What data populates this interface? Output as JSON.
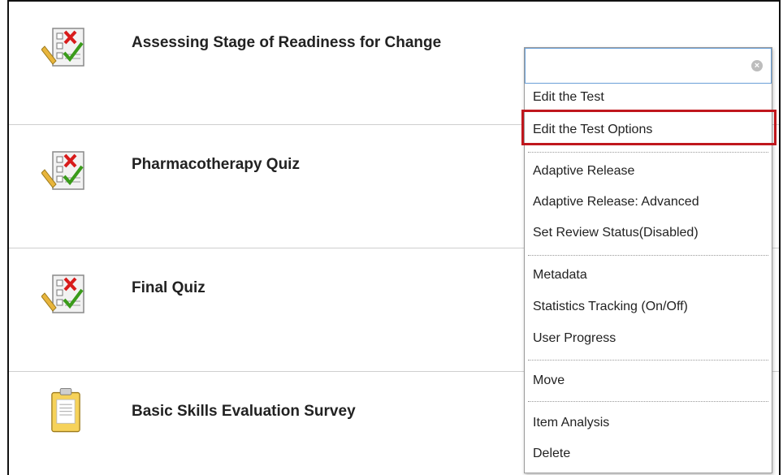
{
  "items": [
    {
      "title": "Assessing Stage of Readiness for Change",
      "icon": "test-icon"
    },
    {
      "title": "Pharmacotherapy Quiz",
      "icon": "test-icon"
    },
    {
      "title": "Final Quiz",
      "icon": "test-icon"
    },
    {
      "title": "Basic Skills Evaluation Survey",
      "icon": "survey-icon"
    }
  ],
  "menu": {
    "search_value": "",
    "groups": [
      [
        "Edit the Test",
        "Edit the Test Options"
      ],
      [
        "Adaptive Release",
        "Adaptive Release: Advanced",
        "Set Review Status(Disabled)"
      ],
      [
        "Metadata",
        "Statistics Tracking (On/Off)",
        "User Progress"
      ],
      [
        "Move"
      ],
      [
        "Item Analysis",
        "Delete"
      ]
    ],
    "highlighted_item": "Edit the Test Options"
  },
  "colors": {
    "highlight_border": "#c0171d",
    "search_border": "#6aa0d8",
    "divider": "#cfcfcf"
  }
}
